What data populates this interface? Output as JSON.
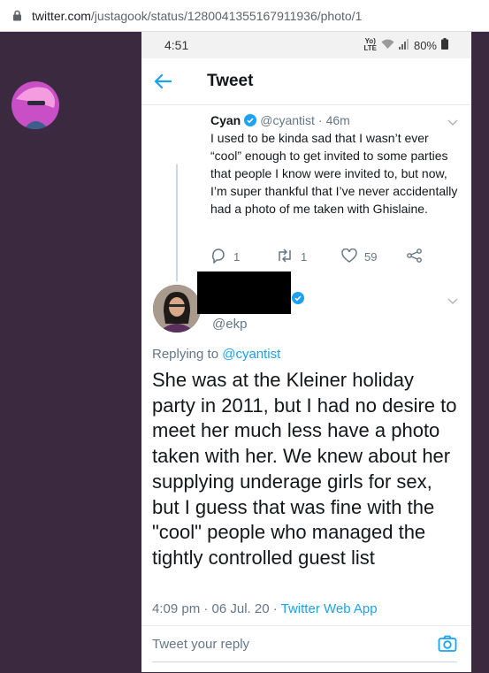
{
  "browser": {
    "url_host": "twitter.com",
    "url_path": "/justagook/status/1280041355167911936/photo/1"
  },
  "status_bar": {
    "time": "4:51",
    "network_top": "Yo)",
    "network_bottom": "LTE",
    "battery": "80%"
  },
  "header": {
    "title": "Tweet"
  },
  "tweet_1": {
    "name": "Cyan",
    "handle": "@cyantist",
    "separator": "·",
    "time": "46m",
    "text": "I used to be kinda sad that I wasn’t ever “cool” enough to get invited to some parties that people I know were invited to, but now, I’m super thankful that I’ve never accidentally had a photo of me taken with Ghislaine.",
    "replies": "1",
    "retweets": "1",
    "likes": "59"
  },
  "tweet_2": {
    "handle": "@ekp",
    "replying_prefix": "Replying to",
    "replying_to": "@cyantist",
    "text": "She was at the Kleiner holiday party in 2011, but I had no desire to meet her much less have a photo taken with her. We knew about her supplying underage girls for sex, but I guess that was fine with the \"cool\" people who managed the tightly controlled guest list",
    "timestamp": "4:09 pm · 06 Jul. 20 · ",
    "source": "Twitter Web App"
  },
  "reply_bar": {
    "placeholder": "Tweet your reply"
  },
  "colors": {
    "accent": "#1da1f2",
    "background_frame": "#3b2a3f",
    "text_secondary": "#657786"
  }
}
